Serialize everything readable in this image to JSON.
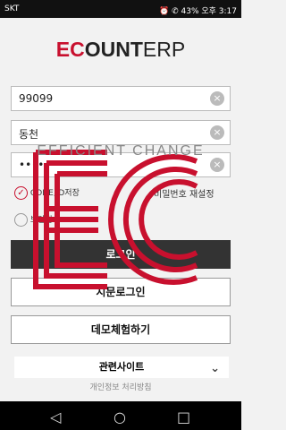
{
  "status": {
    "carrier": "SKT",
    "right": "⏰ ✆ 43% 오후 3:17"
  },
  "logo": {
    "part1": "EC",
    "part2": "OUNT",
    "part3": "ERP"
  },
  "form": {
    "company_code": "99099",
    "user_id": "동천",
    "password": "•••••••••"
  },
  "options": {
    "save_label": "CODE,ID저장",
    "reset_password": "비밀번호 재설정",
    "option2_label": "보안접속"
  },
  "buttons": {
    "login": "로그인",
    "fingerprint_login": "지문로그인",
    "demo": "데모체험하기"
  },
  "related": {
    "label": "관련사이트",
    "chevron": "⌄"
  },
  "privacy": "개인정보 처리방침",
  "watermark": {
    "text": "EFFICIENT CHANGE",
    "logo_color": "#c8102e"
  },
  "nav": {
    "back": "◁",
    "home": "○",
    "recent": "□"
  }
}
